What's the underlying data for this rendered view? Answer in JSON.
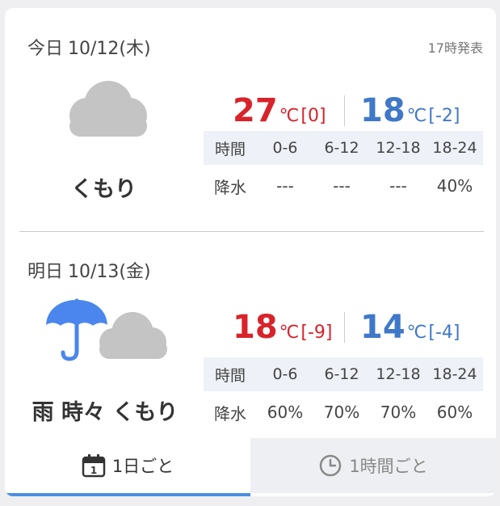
{
  "issued": "17時発表",
  "days": [
    {
      "day_name": "今日",
      "date": "10/12",
      "weekday": "(木)",
      "weather": "くもり",
      "weather_icon": "cloud-icon",
      "high": "27",
      "high_diff": "[0]",
      "low": "18",
      "low_diff": "[-2]",
      "unit": "℃",
      "precip": {
        "header_label": "時間",
        "row_label": "降水",
        "periods": [
          "0-6",
          "6-12",
          "12-18",
          "18-24"
        ],
        "values": [
          "---",
          "---",
          "---",
          "40%"
        ]
      }
    },
    {
      "day_name": "明日",
      "date": "10/13",
      "weekday": "(金)",
      "weather": "雨 時々 くもり",
      "weather_icon": "umbrella-cloud-icon",
      "high": "18",
      "high_diff": "[-9]",
      "low": "14",
      "low_diff": "[-4]",
      "unit": "℃",
      "precip": {
        "header_label": "時間",
        "row_label": "降水",
        "periods": [
          "0-6",
          "6-12",
          "12-18",
          "18-24"
        ],
        "values": [
          "60%",
          "70%",
          "70%",
          "60%"
        ]
      }
    }
  ],
  "tabs": [
    {
      "label": "1日ごと",
      "icon": "calendar-icon",
      "icon_text": "1",
      "active": true
    },
    {
      "label": "1時間ごと",
      "icon": "clock-icon",
      "active": false
    }
  ],
  "colors": {
    "high": "#d8232a",
    "low": "#3f78c8",
    "cloud": "#c4c4c4",
    "umbrella": "#4a86ee",
    "active_tab_bar": "#4a90e2"
  }
}
